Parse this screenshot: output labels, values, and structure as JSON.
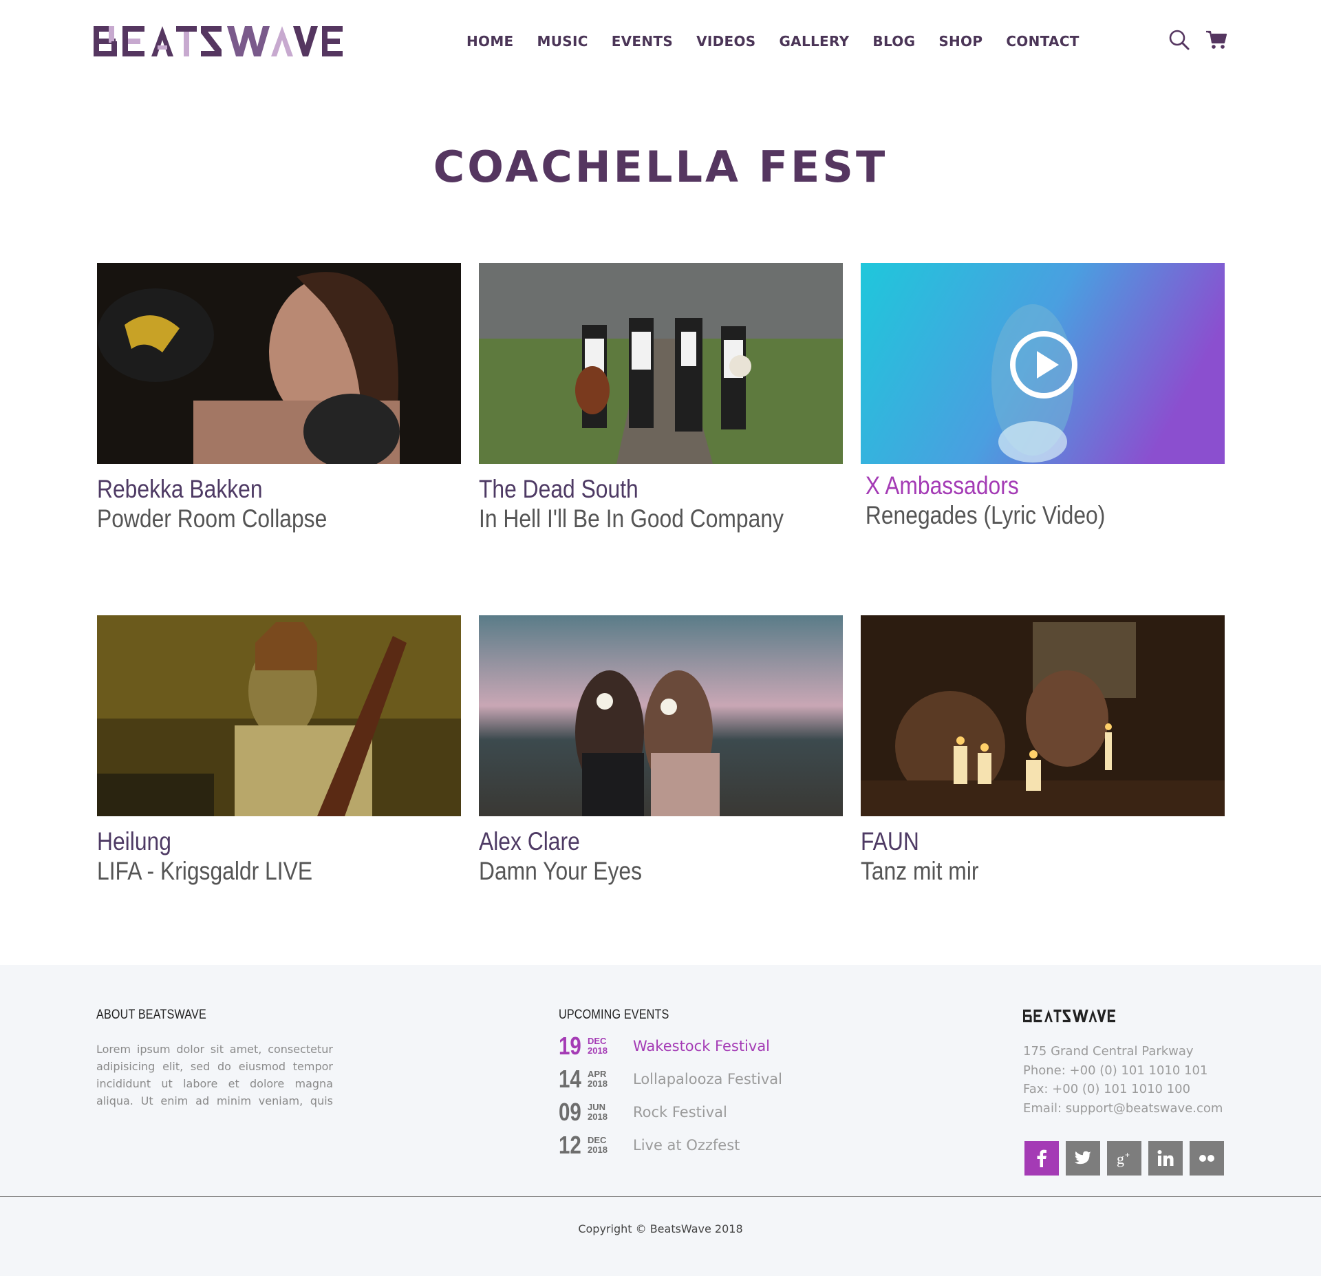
{
  "brand": {
    "logo_text": "BEATSWAVE",
    "primary_color": "#553660",
    "accent_color": "#a43bb5"
  },
  "nav": {
    "items": [
      {
        "label": "HOME"
      },
      {
        "label": "MUSIC"
      },
      {
        "label": "EVENTS"
      },
      {
        "label": "VIDEOS"
      },
      {
        "label": "GALLERY"
      },
      {
        "label": "BLOG"
      },
      {
        "label": "SHOP"
      },
      {
        "label": "CONTACT"
      }
    ],
    "icons": [
      "search-icon",
      "cart-icon"
    ]
  },
  "page": {
    "title": "COACHELLA FEST"
  },
  "videos": [
    {
      "artist": "Rebekka Bakken",
      "title": "Powder Room Collapse"
    },
    {
      "artist": "The Dead South",
      "title": "In Hell I'll Be In Good Company"
    },
    {
      "artist": "X Ambassadors",
      "title": "Renegades (Lyric Video)",
      "active": true
    },
    {
      "artist": "Heilung",
      "title": "LIFA - Krigsgaldr LIVE"
    },
    {
      "artist": "Alex Clare",
      "title": "Damn Your Eyes"
    },
    {
      "artist": "FAUN",
      "title": "Tanz mit mir"
    }
  ],
  "footer": {
    "about": {
      "heading": "ABOUT BEATSWAVE",
      "text": "Lorem ipsum dolor sit amet, consectetur adipisicing elit, sed do eiusmod tempor incididunt ut labore et dolore magna aliqua. Ut enim ad minim veniam, quis nostrud exercitation ullamco laboris nisi ut aliquip ex ea commodo consequat. Duis aute irure dolor in reprehenderit in voluptate velit"
    },
    "events": {
      "heading": "UPCOMING EVENTS",
      "items": [
        {
          "day": "19",
          "month": "DEC",
          "year": "2018",
          "name": "Wakestock Festival",
          "highlight": true
        },
        {
          "day": "14",
          "month": "APR",
          "year": "2018",
          "name": "Lollapalooza Festival"
        },
        {
          "day": "09",
          "month": "JUN",
          "year": "2018",
          "name": "Rock Festival"
        },
        {
          "day": "12",
          "month": "DEC",
          "year": "2018",
          "name": "Live at Ozzfest"
        }
      ]
    },
    "contact": {
      "logo_text": "BEATSWAVE",
      "address": "175 Grand Central Parkway",
      "phone": "Phone: +00 (0) 101 1010 101",
      "fax": "Fax: +00 (0) 101 1010 100",
      "email": "Email: support@beatswave.com"
    },
    "socials": [
      "facebook-icon",
      "twitter-icon",
      "google-plus-icon",
      "linkedin-icon",
      "flickr-icon"
    ],
    "copyright": "Copyright © BeatsWave 2018"
  }
}
